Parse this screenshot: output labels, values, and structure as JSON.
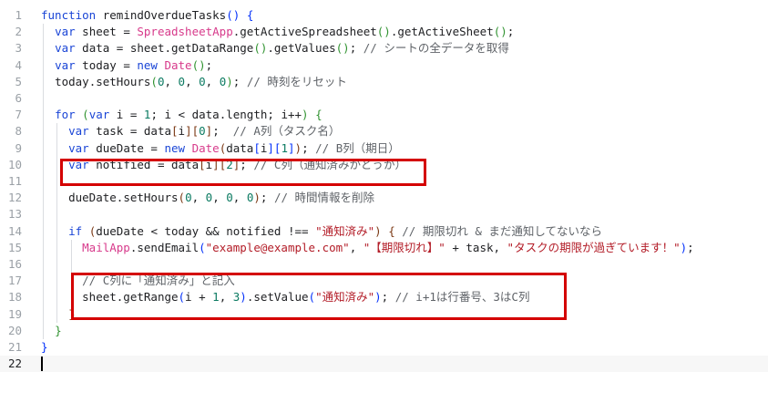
{
  "editor": {
    "line_numbers": [
      "1",
      "2",
      "3",
      "4",
      "5",
      "6",
      "7",
      "8",
      "9",
      "10",
      "11",
      "12",
      "13",
      "14",
      "15",
      "16",
      "17",
      "18",
      "19",
      "20",
      "21",
      "22"
    ],
    "current_line": "22",
    "lines": [
      [
        {
          "t": "kw",
          "v": "function"
        },
        {
          "t": "id",
          "v": " remindOverdueTasks"
        },
        {
          "t": "br1",
          "v": "()"
        },
        {
          "t": "pun",
          "v": " "
        },
        {
          "t": "br1",
          "v": "{"
        }
      ],
      [
        {
          "t": "pun",
          "v": "  "
        },
        {
          "t": "kw",
          "v": "var"
        },
        {
          "t": "id",
          "v": " sheet = "
        },
        {
          "t": "cls",
          "v": "SpreadsheetApp"
        },
        {
          "t": "id",
          "v": ".getActiveSpreadsheet"
        },
        {
          "t": "br2",
          "v": "()"
        },
        {
          "t": "id",
          "v": ".getActiveSheet"
        },
        {
          "t": "br2",
          "v": "()"
        },
        {
          "t": "pun",
          "v": ";"
        }
      ],
      [
        {
          "t": "pun",
          "v": "  "
        },
        {
          "t": "kw",
          "v": "var"
        },
        {
          "t": "id",
          "v": " data = sheet.getDataRange"
        },
        {
          "t": "br2",
          "v": "()"
        },
        {
          "t": "id",
          "v": ".getValues"
        },
        {
          "t": "br2",
          "v": "()"
        },
        {
          "t": "pun",
          "v": "; "
        },
        {
          "t": "com",
          "v": "// シートの全データを取得"
        }
      ],
      [
        {
          "t": "pun",
          "v": "  "
        },
        {
          "t": "kw",
          "v": "var"
        },
        {
          "t": "id",
          "v": " today = "
        },
        {
          "t": "kw",
          "v": "new"
        },
        {
          "t": "pun",
          "v": " "
        },
        {
          "t": "cls",
          "v": "Date"
        },
        {
          "t": "br2",
          "v": "()"
        },
        {
          "t": "pun",
          "v": ";"
        }
      ],
      [
        {
          "t": "pun",
          "v": "  "
        },
        {
          "t": "id",
          "v": "today.setHours"
        },
        {
          "t": "br2",
          "v": "("
        },
        {
          "t": "num",
          "v": "0"
        },
        {
          "t": "pun",
          "v": ", "
        },
        {
          "t": "num",
          "v": "0"
        },
        {
          "t": "pun",
          "v": ", "
        },
        {
          "t": "num",
          "v": "0"
        },
        {
          "t": "pun",
          "v": ", "
        },
        {
          "t": "num",
          "v": "0"
        },
        {
          "t": "br2",
          "v": ")"
        },
        {
          "t": "pun",
          "v": "; "
        },
        {
          "t": "com",
          "v": "// 時刻をリセット"
        }
      ],
      [],
      [
        {
          "t": "pun",
          "v": "  "
        },
        {
          "t": "kw",
          "v": "for"
        },
        {
          "t": "pun",
          "v": " "
        },
        {
          "t": "br2",
          "v": "("
        },
        {
          "t": "kw",
          "v": "var"
        },
        {
          "t": "id",
          "v": " i = "
        },
        {
          "t": "num",
          "v": "1"
        },
        {
          "t": "id",
          "v": "; i < data.length; i++"
        },
        {
          "t": "br2",
          "v": ")"
        },
        {
          "t": "pun",
          "v": " "
        },
        {
          "t": "br2",
          "v": "{"
        }
      ],
      [
        {
          "t": "pun",
          "v": "    "
        },
        {
          "t": "kw",
          "v": "var"
        },
        {
          "t": "id",
          "v": " task = data"
        },
        {
          "t": "br3",
          "v": "["
        },
        {
          "t": "id",
          "v": "i"
        },
        {
          "t": "br3",
          "v": "]["
        },
        {
          "t": "num",
          "v": "0"
        },
        {
          "t": "br3",
          "v": "]"
        },
        {
          "t": "pun",
          "v": ";  "
        },
        {
          "t": "com",
          "v": "// A列（タスク名）"
        }
      ],
      [
        {
          "t": "pun",
          "v": "    "
        },
        {
          "t": "kw",
          "v": "var"
        },
        {
          "t": "id",
          "v": " dueDate = "
        },
        {
          "t": "kw",
          "v": "new"
        },
        {
          "t": "pun",
          "v": " "
        },
        {
          "t": "cls",
          "v": "Date"
        },
        {
          "t": "br3",
          "v": "("
        },
        {
          "t": "id",
          "v": "data"
        },
        {
          "t": "br1",
          "v": "["
        },
        {
          "t": "id",
          "v": "i"
        },
        {
          "t": "br1",
          "v": "]["
        },
        {
          "t": "num",
          "v": "1"
        },
        {
          "t": "br1",
          "v": "]"
        },
        {
          "t": "br3",
          "v": ")"
        },
        {
          "t": "pun",
          "v": "; "
        },
        {
          "t": "com",
          "v": "// B列（期日）"
        }
      ],
      [
        {
          "t": "pun",
          "v": "    "
        },
        {
          "t": "kw",
          "v": "var"
        },
        {
          "t": "id",
          "v": " notified = data"
        },
        {
          "t": "br3",
          "v": "["
        },
        {
          "t": "id",
          "v": "i"
        },
        {
          "t": "br3",
          "v": "]["
        },
        {
          "t": "num",
          "v": "2"
        },
        {
          "t": "br3",
          "v": "]"
        },
        {
          "t": "pun",
          "v": "; "
        },
        {
          "t": "com",
          "v": "// C列（通知済みかどうか）"
        }
      ],
      [],
      [
        {
          "t": "pun",
          "v": "    "
        },
        {
          "t": "id",
          "v": "dueDate.setHours"
        },
        {
          "t": "br3",
          "v": "("
        },
        {
          "t": "num",
          "v": "0"
        },
        {
          "t": "pun",
          "v": ", "
        },
        {
          "t": "num",
          "v": "0"
        },
        {
          "t": "pun",
          "v": ", "
        },
        {
          "t": "num",
          "v": "0"
        },
        {
          "t": "pun",
          "v": ", "
        },
        {
          "t": "num",
          "v": "0"
        },
        {
          "t": "br3",
          "v": ")"
        },
        {
          "t": "pun",
          "v": "; "
        },
        {
          "t": "com",
          "v": "// 時間情報を削除"
        }
      ],
      [],
      [
        {
          "t": "pun",
          "v": "    "
        },
        {
          "t": "kw",
          "v": "if"
        },
        {
          "t": "pun",
          "v": " "
        },
        {
          "t": "br3",
          "v": "("
        },
        {
          "t": "id",
          "v": "dueDate < today && notified !== "
        },
        {
          "t": "str",
          "v": "\"通知済み\""
        },
        {
          "t": "br3",
          "v": ")"
        },
        {
          "t": "pun",
          "v": " "
        },
        {
          "t": "br3",
          "v": "{"
        },
        {
          "t": "pun",
          "v": " "
        },
        {
          "t": "com",
          "v": "// 期限切れ & まだ通知してないなら"
        }
      ],
      [
        {
          "t": "pun",
          "v": "      "
        },
        {
          "t": "cls",
          "v": "MailApp"
        },
        {
          "t": "id",
          "v": ".sendEmail"
        },
        {
          "t": "br1",
          "v": "("
        },
        {
          "t": "str",
          "v": "\"example@example.com\""
        },
        {
          "t": "pun",
          "v": ", "
        },
        {
          "t": "str",
          "v": "\"【期限切れ】\""
        },
        {
          "t": "id",
          "v": " + task, "
        },
        {
          "t": "str",
          "v": "\"タスクの期限が過ぎています！\""
        },
        {
          "t": "br1",
          "v": ")"
        },
        {
          "t": "pun",
          "v": ";"
        }
      ],
      [],
      [
        {
          "t": "pun",
          "v": "      "
        },
        {
          "t": "com",
          "v": "// C列に「通知済み」と記入"
        }
      ],
      [
        {
          "t": "pun",
          "v": "      "
        },
        {
          "t": "id",
          "v": "sheet.getRange"
        },
        {
          "t": "br1",
          "v": "("
        },
        {
          "t": "id",
          "v": "i + "
        },
        {
          "t": "num",
          "v": "1"
        },
        {
          "t": "pun",
          "v": ", "
        },
        {
          "t": "num",
          "v": "3"
        },
        {
          "t": "br1",
          "v": ")"
        },
        {
          "t": "id",
          "v": ".setValue"
        },
        {
          "t": "br1",
          "v": "("
        },
        {
          "t": "str",
          "v": "\"通知済み\""
        },
        {
          "t": "br1",
          "v": ")"
        },
        {
          "t": "pun",
          "v": "; "
        },
        {
          "t": "com",
          "v": "// i+1は行番号、3はC列"
        }
      ],
      [
        {
          "t": "pun",
          "v": "    "
        },
        {
          "t": "br3",
          "v": "}"
        }
      ],
      [
        {
          "t": "pun",
          "v": "  "
        },
        {
          "t": "br2",
          "v": "}"
        }
      ],
      [
        {
          "t": "br1",
          "v": "}"
        }
      ],
      []
    ]
  },
  "colors": {
    "keyword": "#1a45d6",
    "class_name": "#d73a8b",
    "number": "#0b7a61",
    "string": "#b31d28",
    "comment": "#5f6368",
    "highlight_box": "#d40000"
  }
}
